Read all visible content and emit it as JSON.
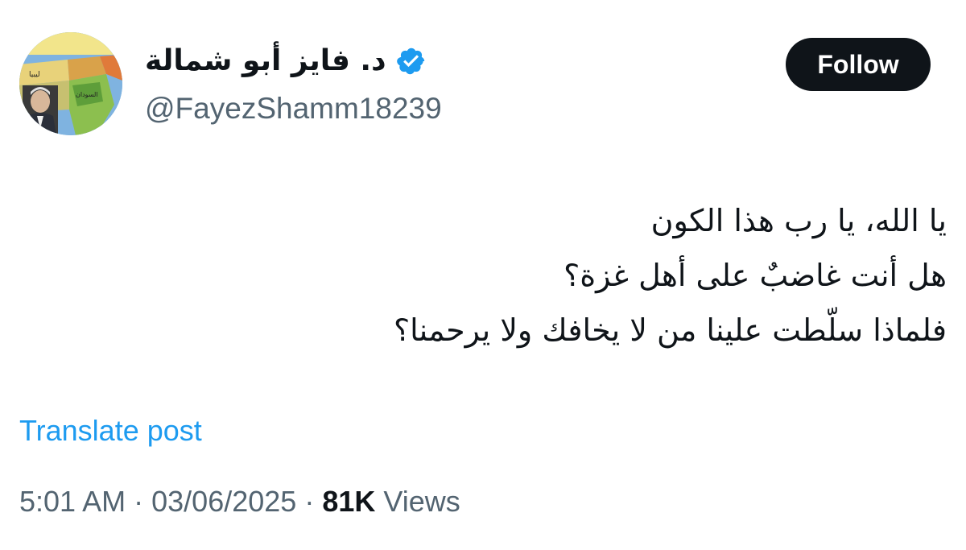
{
  "author": {
    "display_name": "د. فايز أبو شمالة",
    "handle": "@FayezShamm18239",
    "verified_icon": "verified-badge-icon",
    "avatar_map_labels": {
      "libya": "ليبيا",
      "sudan": "السودان"
    }
  },
  "follow_label": "Follow",
  "post": {
    "lines": [
      "يا الله، يا رب هذا الكون",
      "هل أنت غاضبٌ على أهل غزة؟",
      "فلماذا سلّطت علينا من لا يخافك ولا يرحمنا؟"
    ]
  },
  "translate_label": "Translate post",
  "meta": {
    "time": "5:01 AM",
    "separator": "·",
    "date": "03/06/2025",
    "views_count": "81K",
    "views_label": "Views"
  },
  "colors": {
    "accent": "#1d9bf0",
    "text": "#0f1419",
    "secondary": "#536471",
    "button": "#0f1419"
  }
}
